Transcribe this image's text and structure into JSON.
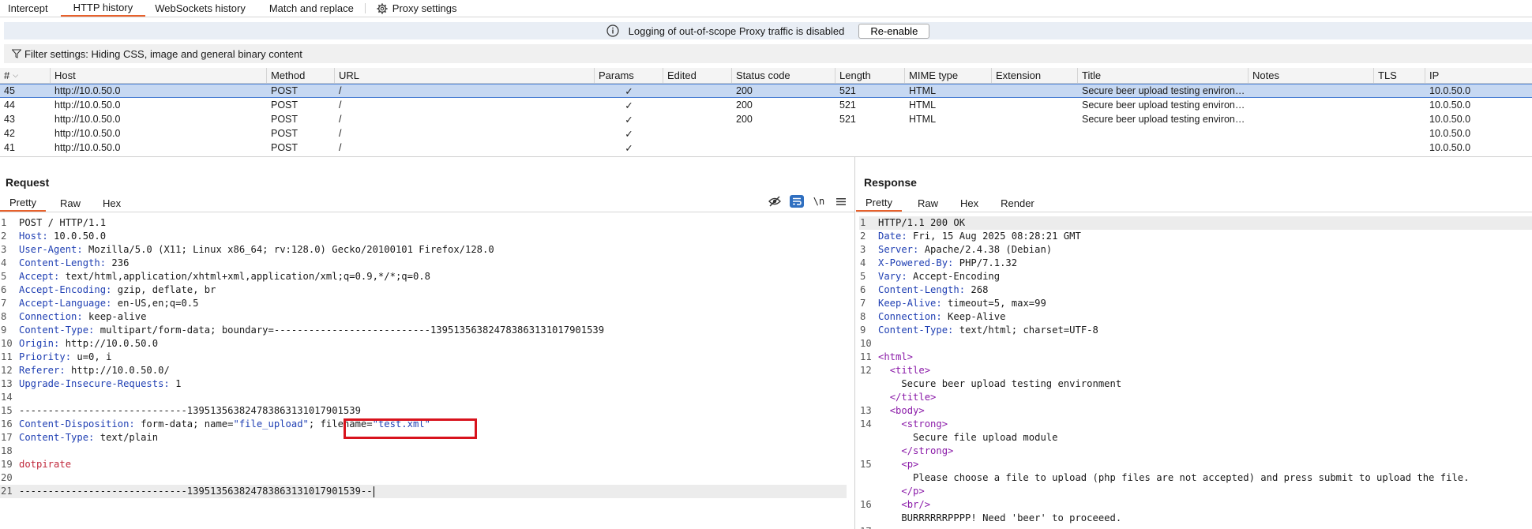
{
  "tabs": [
    {
      "label": "Intercept",
      "active": false
    },
    {
      "label": "HTTP history",
      "active": true
    },
    {
      "label": "WebSockets history",
      "active": false
    },
    {
      "label": "Match and replace",
      "active": false
    },
    {
      "label": "Proxy settings",
      "active": false
    }
  ],
  "infobar": {
    "text": "Logging of out-of-scope Proxy traffic is disabled",
    "button": "Re-enable"
  },
  "filter": {
    "text": "Filter settings: Hiding CSS, image and general binary content"
  },
  "table": {
    "columns": [
      "#",
      "Host",
      "Method",
      "URL",
      "Params",
      "Edited",
      "Status code",
      "Length",
      "MIME type",
      "Extension",
      "Title",
      "Notes",
      "TLS",
      "IP"
    ],
    "rows": [
      {
        "num": "45",
        "host": "http://10.0.50.0",
        "method": "POST",
        "url": "/",
        "params": "✓",
        "status": "200",
        "length": "521",
        "mime": "HTML",
        "title": "Secure beer upload testing environ…",
        "ip": "10.0.50.0",
        "selected": true
      },
      {
        "num": "44",
        "host": "http://10.0.50.0",
        "method": "POST",
        "url": "/",
        "params": "✓",
        "status": "200",
        "length": "521",
        "mime": "HTML",
        "title": "Secure beer upload testing environ…",
        "ip": "10.0.50.0",
        "selected": false
      },
      {
        "num": "43",
        "host": "http://10.0.50.0",
        "method": "POST",
        "url": "/",
        "params": "✓",
        "status": "200",
        "length": "521",
        "mime": "HTML",
        "title": "Secure beer upload testing environ…",
        "ip": "10.0.50.0",
        "selected": false
      },
      {
        "num": "42",
        "host": "http://10.0.50.0",
        "method": "POST",
        "url": "/",
        "params": "✓",
        "status": "",
        "length": "",
        "mime": "",
        "title": "",
        "ip": "10.0.50.0",
        "selected": false
      },
      {
        "num": "41",
        "host": "http://10.0.50.0",
        "method": "POST",
        "url": "/",
        "params": "✓",
        "status": "",
        "length": "",
        "mime": "",
        "title": "",
        "ip": "10.0.50.0",
        "selected": false
      }
    ]
  },
  "request": {
    "title": "Request",
    "tabs": [
      "Pretty",
      "Raw",
      "Hex"
    ],
    "tools": [
      "\\n"
    ],
    "lines": [
      [
        {
          "t": "POST / HTTP/1.1"
        }
      ],
      [
        {
          "t": "Host:",
          "c": "hn"
        },
        {
          "t": " 10.0.50.0"
        }
      ],
      [
        {
          "t": "User-Agent:",
          "c": "hn"
        },
        {
          "t": " Mozilla/5.0 (X11; Linux x86_64; rv:128.0) Gecko/20100101 Firefox/128.0"
        }
      ],
      [
        {
          "t": "Content-Length:",
          "c": "hn"
        },
        {
          "t": " 236"
        }
      ],
      [
        {
          "t": "Accept:",
          "c": "hn"
        },
        {
          "t": " text/html,application/xhtml+xml,application/xml;q=0.9,*/*;q=0.8"
        }
      ],
      [
        {
          "t": "Accept-Encoding:",
          "c": "hn"
        },
        {
          "t": " gzip, deflate, br"
        }
      ],
      [
        {
          "t": "Accept-Language:",
          "c": "hn"
        },
        {
          "t": " en-US,en;q=0.5"
        }
      ],
      [
        {
          "t": "Connection:",
          "c": "hn"
        },
        {
          "t": " keep-alive"
        }
      ],
      [
        {
          "t": "Content-Type:",
          "c": "hn"
        },
        {
          "t": " multipart/form-data; boundary=---------------------------139513563824783863131017901539"
        }
      ],
      [
        {
          "t": "Origin:",
          "c": "hn"
        },
        {
          "t": " http://10.0.50.0"
        }
      ],
      [
        {
          "t": "Priority:",
          "c": "hn"
        },
        {
          "t": " u=0, i"
        }
      ],
      [
        {
          "t": "Referer:",
          "c": "hn"
        },
        {
          "t": " http://10.0.50.0/"
        }
      ],
      [
        {
          "t": "Upgrade-Insecure-Requests:",
          "c": "hn"
        },
        {
          "t": " 1"
        }
      ],
      [
        {
          "t": ""
        }
      ],
      [
        {
          "t": "-----------------------------139513563824783863131017901539"
        }
      ],
      [
        {
          "t": "Content-Disposition:",
          "c": "hn"
        },
        {
          "t": " form-data; name="
        },
        {
          "t": "\"file_upload\"",
          "c": "str"
        },
        {
          "t": "; filename="
        },
        {
          "t": "\"test.xml\"",
          "c": "str"
        }
      ],
      [
        {
          "t": "Content-Type:",
          "c": "hn"
        },
        {
          "t": " text/plain"
        }
      ],
      [
        {
          "t": ""
        }
      ],
      [
        {
          "t": "dotpirate",
          "c": "red"
        }
      ],
      [
        {
          "t": ""
        }
      ],
      [
        {
          "t": "-----------------------------139513563824783863131017901539--"
        }
      ]
    ]
  },
  "response": {
    "title": "Response",
    "tabs": [
      "Pretty",
      "Raw",
      "Hex",
      "Render"
    ],
    "lines": [
      {
        "n": "1",
        "parts": [
          {
            "t": "HTTP/1.1 200 OK"
          }
        ]
      },
      {
        "n": "2",
        "parts": [
          {
            "t": "Date:",
            "c": "hn"
          },
          {
            "t": " Fri, 15 Aug 2025 08:28:21 GMT"
          }
        ]
      },
      {
        "n": "3",
        "parts": [
          {
            "t": "Server:",
            "c": "hn"
          },
          {
            "t": " Apache/2.4.38 (Debian)"
          }
        ]
      },
      {
        "n": "4",
        "parts": [
          {
            "t": "X-Powered-By:",
            "c": "hn"
          },
          {
            "t": " PHP/7.1.32"
          }
        ]
      },
      {
        "n": "5",
        "parts": [
          {
            "t": "Vary:",
            "c": "hn"
          },
          {
            "t": " Accept-Encoding"
          }
        ]
      },
      {
        "n": "6",
        "parts": [
          {
            "t": "Content-Length:",
            "c": "hn"
          },
          {
            "t": " 268"
          }
        ]
      },
      {
        "n": "7",
        "parts": [
          {
            "t": "Keep-Alive:",
            "c": "hn"
          },
          {
            "t": " timeout=5, max=99"
          }
        ]
      },
      {
        "n": "8",
        "parts": [
          {
            "t": "Connection:",
            "c": "hn"
          },
          {
            "t": " Keep-Alive"
          }
        ]
      },
      {
        "n": "9",
        "parts": [
          {
            "t": "Content-Type:",
            "c": "hn"
          },
          {
            "t": " text/html; charset=UTF-8"
          }
        ]
      },
      {
        "n": "10",
        "parts": [
          {
            "t": ""
          }
        ]
      },
      {
        "n": "11",
        "parts": [
          {
            "t": "<html>",
            "c": "tag"
          }
        ]
      },
      {
        "n": "12",
        "parts": [
          {
            "t": "  "
          },
          {
            "t": "<title>",
            "c": "tag"
          }
        ]
      },
      {
        "n": "",
        "parts": [
          {
            "t": "    Secure beer upload testing environment"
          }
        ]
      },
      {
        "n": "",
        "parts": [
          {
            "t": "  "
          },
          {
            "t": "</title>",
            "c": "tag"
          }
        ]
      },
      {
        "n": "13",
        "parts": [
          {
            "t": "  "
          },
          {
            "t": "<body>",
            "c": "tag"
          }
        ]
      },
      {
        "n": "14",
        "parts": [
          {
            "t": "    "
          },
          {
            "t": "<strong>",
            "c": "tag"
          }
        ]
      },
      {
        "n": "",
        "parts": [
          {
            "t": "      Secure file upload module"
          }
        ]
      },
      {
        "n": "",
        "parts": [
          {
            "t": "    "
          },
          {
            "t": "</strong>",
            "c": "tag"
          }
        ]
      },
      {
        "n": "15",
        "parts": [
          {
            "t": "    "
          },
          {
            "t": "<p>",
            "c": "tag"
          }
        ]
      },
      {
        "n": "",
        "parts": [
          {
            "t": "      Please choose a file to upload (php files are not accepted) and press submit to upload the file."
          }
        ]
      },
      {
        "n": "",
        "parts": [
          {
            "t": "    "
          },
          {
            "t": "</p>",
            "c": "tag"
          }
        ]
      },
      {
        "n": "16",
        "parts": [
          {
            "t": "    "
          },
          {
            "t": "<br/>",
            "c": "tag"
          }
        ]
      },
      {
        "n": "",
        "parts": [
          {
            "t": "    BURRRRRRPPPP! Need 'beer' to proceeed."
          }
        ]
      },
      {
        "n": "17",
        "parts": [
          {
            "t": ""
          }
        ]
      }
    ]
  },
  "colors": {
    "accent": "#e8612c",
    "selection": "#c6d8f2",
    "header_name": "#1f3fb3",
    "annotation": "#d8131d",
    "tag": "#8a1aa8"
  }
}
